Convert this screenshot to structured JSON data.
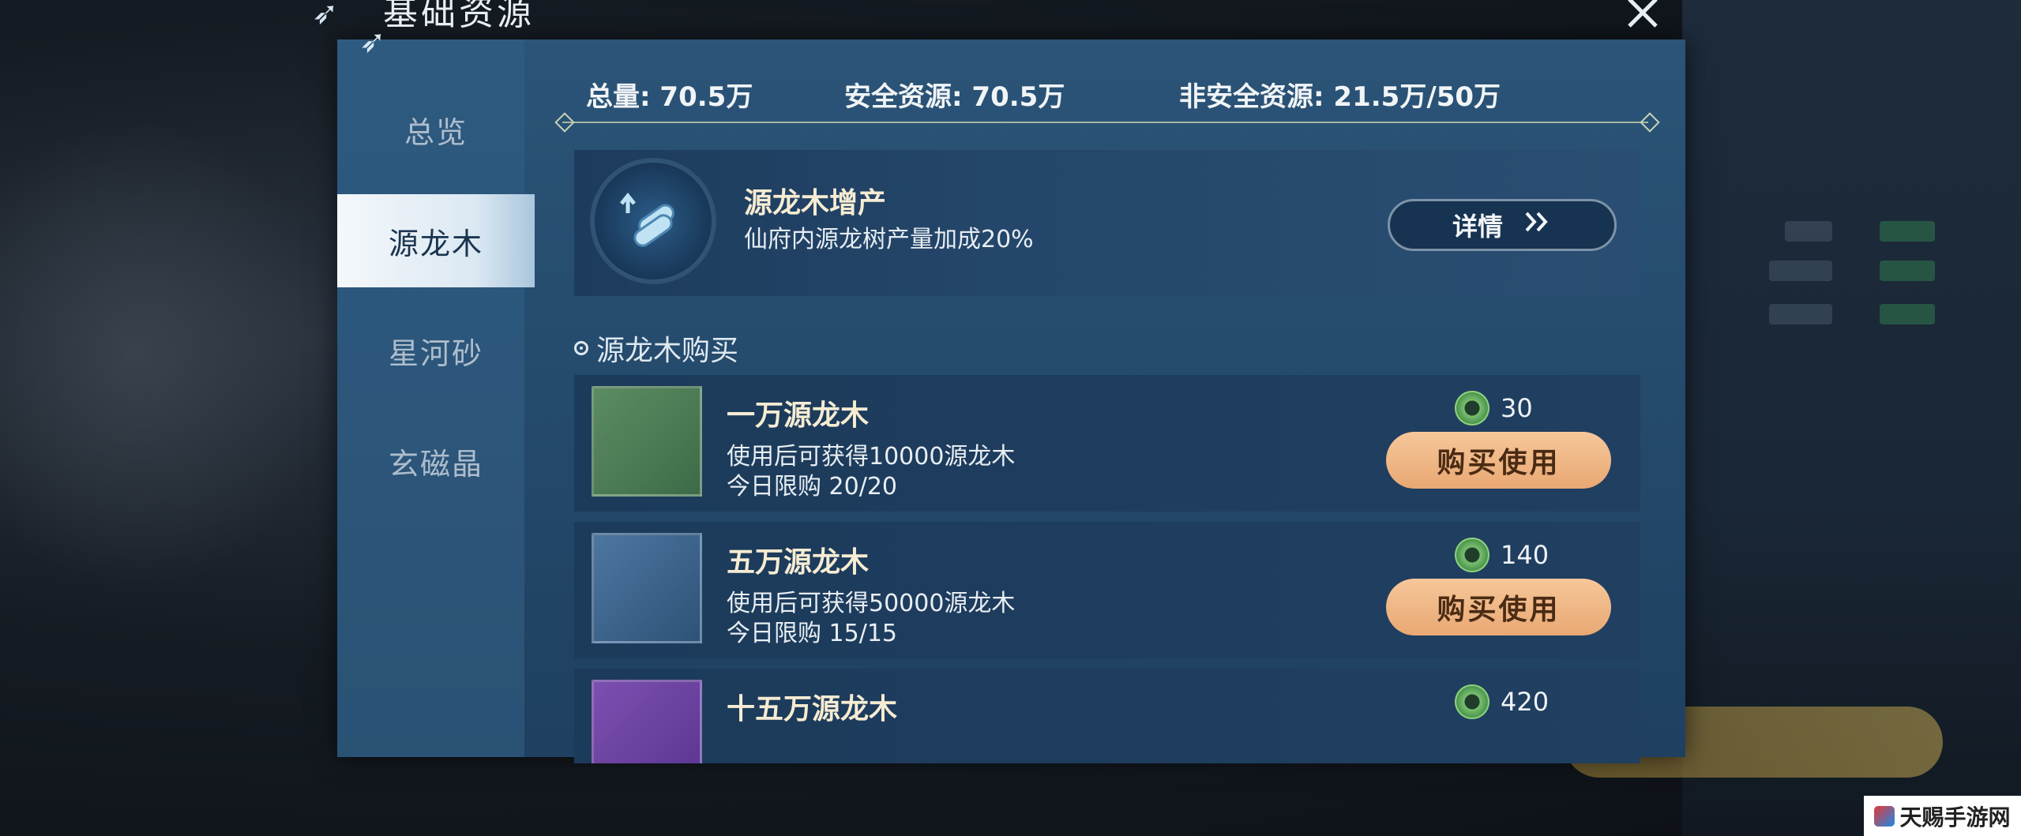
{
  "window": {
    "title": "基础资源",
    "close_icon": "close-x-icon"
  },
  "sidebar": {
    "items": [
      {
        "label": "总览",
        "active": false
      },
      {
        "label": "源龙木",
        "active": true
      },
      {
        "label": "星河砂",
        "active": false
      },
      {
        "label": "玄磁晶",
        "active": false
      }
    ]
  },
  "stats": {
    "total": "总量: 70.5万",
    "safe": "安全资源: 70.5万",
    "unsafe": "非安全资源: 21.5万/50万"
  },
  "boost": {
    "icon": "wood-scroll-icon",
    "title": "源龙木增产",
    "desc": "仙府内源龙树产量加成20%",
    "detail_label": "详情"
  },
  "purchase": {
    "section_title": "源龙木购买",
    "items": [
      {
        "name": "一万源龙木",
        "desc": "使用后可获得10000源龙木",
        "limit": "今日限购 20/20",
        "price": "30",
        "button": "购买使用",
        "thumb_color": "green"
      },
      {
        "name": "五万源龙木",
        "desc": "使用后可获得50000源龙木",
        "limit": "今日限购 15/15",
        "price": "140",
        "button": "购买使用",
        "thumb_color": "blue"
      },
      {
        "name": "十五万源龙木",
        "desc": "",
        "limit": "",
        "price": "420",
        "button": "",
        "thumb_color": "purple"
      }
    ]
  },
  "watermark": {
    "text": "天赐手游网"
  },
  "colors": {
    "accent_button": "#e9a873",
    "panel_bg": "#244a6c",
    "title_gold": "#f6ecd2"
  }
}
